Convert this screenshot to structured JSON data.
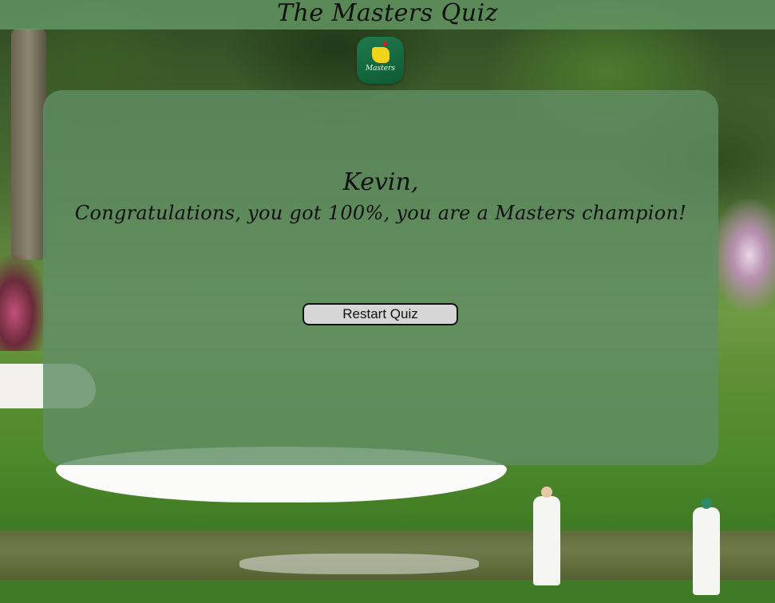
{
  "header": {
    "title": "The Masters Quiz"
  },
  "logo": {
    "text": "Masters",
    "icon": "masters-logo-icon",
    "color_background": "#1f7a4c",
    "color_map": "#f2d31c",
    "color_flag": "#d02020"
  },
  "result": {
    "name": "Kevin,",
    "message": "Congratulations, you got 100%, you are a Masters champion!"
  },
  "actions": {
    "restart_label": "Restart Quiz"
  },
  "colors": {
    "header_bg": "rgba(104,156,104,0.78)",
    "panel_bg": "rgba(96,142,100,0.82)",
    "button_bg": "#d6d6d6"
  }
}
